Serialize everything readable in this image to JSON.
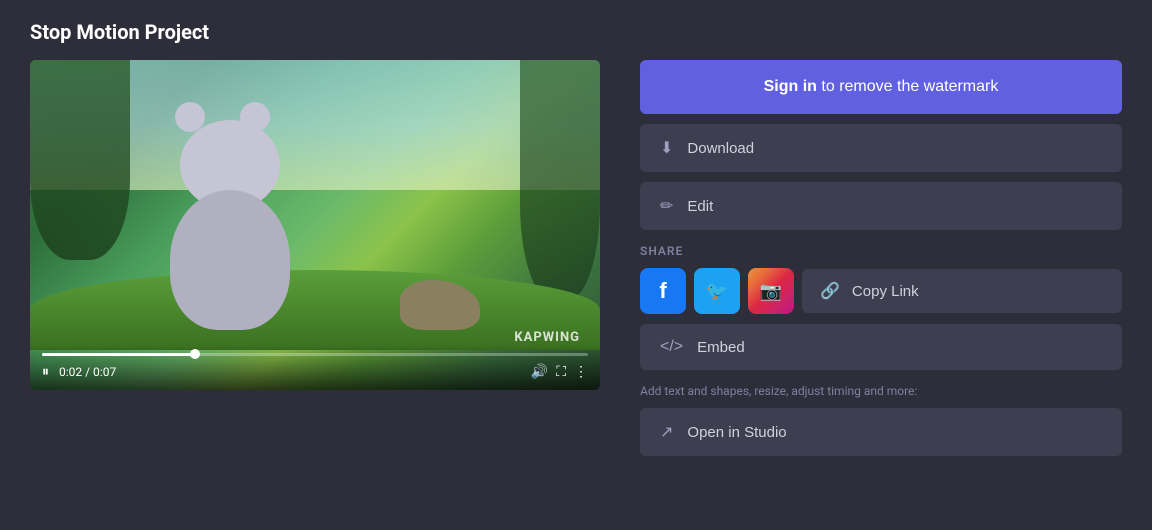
{
  "page": {
    "title": "Stop Motion Project",
    "background_color": "#2e2e3a"
  },
  "video": {
    "current_time": "0:02",
    "total_time": "0:07",
    "progress_percent": 28,
    "watermark": "KAPWING"
  },
  "right_panel": {
    "sign_in_label": "to remove the watermark",
    "sign_in_bold": "Sign in",
    "download_label": "Download",
    "edit_label": "Edit",
    "share_label": "SHARE",
    "copy_link_label": "Copy Link",
    "embed_label": "Embed",
    "studio_note": "Add text and shapes, resize, adjust timing and more:",
    "open_studio_label": "Open in Studio",
    "social": {
      "facebook_label": "f",
      "twitter_label": "🐦",
      "instagram_label": "📷"
    }
  }
}
